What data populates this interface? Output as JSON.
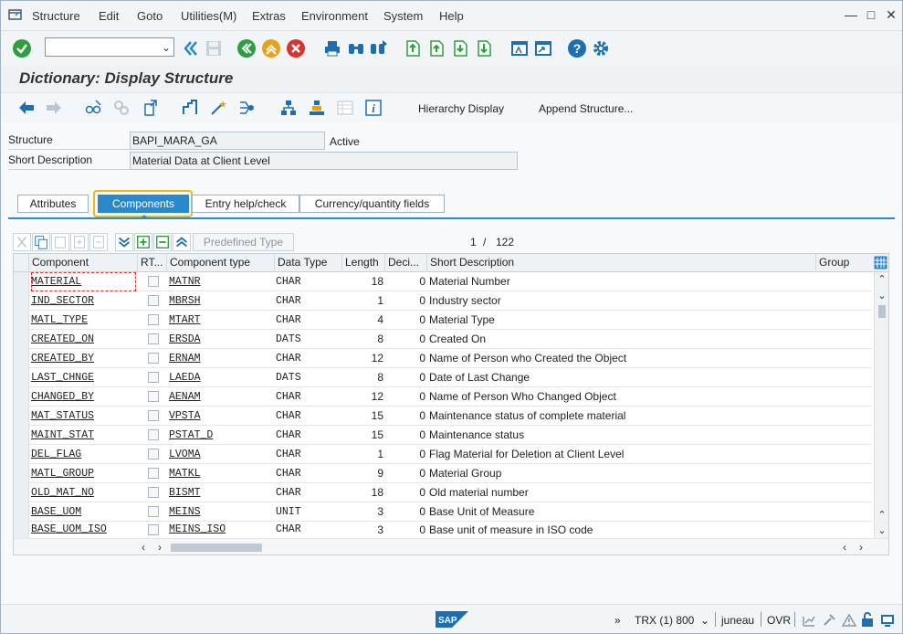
{
  "menubar": {
    "items": [
      "Structure",
      "Edit",
      "Goto",
      "Utilities(M)",
      "Extras",
      "Environment",
      "System",
      "Help"
    ]
  },
  "toolbar": {
    "command_field_value": ""
  },
  "title": "Dictionary: Display Structure",
  "apptoolbar": {
    "hierarchy_display": "Hierarchy Display",
    "append_structure": "Append Structure..."
  },
  "header": {
    "structure_label": "Structure",
    "structure_value": "BAPI_MARA_GA",
    "status": "Active",
    "short_desc_label": "Short Description",
    "short_desc_value": "Material Data at Client Level"
  },
  "tabs": [
    {
      "label": "Attributes",
      "active": false
    },
    {
      "label": "Components",
      "active": true
    },
    {
      "label": "Entry help/check",
      "active": false
    },
    {
      "label": "Currency/quantity fields",
      "active": false
    }
  ],
  "table_toolbar": {
    "predefined_type": "Predefined Type",
    "pager_current": "1",
    "pager_sep": "/",
    "pager_total": "122"
  },
  "grid": {
    "columns": [
      "Component",
      "RT...",
      "Component type",
      "Data Type",
      "Length",
      "Deci...",
      "Short Description",
      "Group"
    ],
    "rows": [
      {
        "component": "MATERIAL",
        "type": "MATNR",
        "dtype": "CHAR",
        "length": "18",
        "dec": "0",
        "desc": "Material Number"
      },
      {
        "component": "IND_SECTOR",
        "type": "MBRSH",
        "dtype": "CHAR",
        "length": "1",
        "dec": "0",
        "desc": "Industry sector"
      },
      {
        "component": "MATL_TYPE",
        "type": "MTART",
        "dtype": "CHAR",
        "length": "4",
        "dec": "0",
        "desc": "Material Type"
      },
      {
        "component": "CREATED_ON",
        "type": "ERSDA",
        "dtype": "DATS",
        "length": "8",
        "dec": "0",
        "desc": "Created On"
      },
      {
        "component": "CREATED_BY",
        "type": "ERNAM",
        "dtype": "CHAR",
        "length": "12",
        "dec": "0",
        "desc": "Name of Person who Created the Object"
      },
      {
        "component": "LAST_CHNGE",
        "type": "LAEDA",
        "dtype": "DATS",
        "length": "8",
        "dec": "0",
        "desc": "Date of Last Change"
      },
      {
        "component": "CHANGED_BY",
        "type": "AENAM",
        "dtype": "CHAR",
        "length": "12",
        "dec": "0",
        "desc": "Name of Person Who Changed Object"
      },
      {
        "component": "MAT_STATUS",
        "type": "VPSTA",
        "dtype": "CHAR",
        "length": "15",
        "dec": "0",
        "desc": "Maintenance status of complete material"
      },
      {
        "component": "MAINT_STAT",
        "type": "PSTAT_D",
        "dtype": "CHAR",
        "length": "15",
        "dec": "0",
        "desc": "Maintenance status"
      },
      {
        "component": "DEL_FLAG",
        "type": "LVOMA",
        "dtype": "CHAR",
        "length": "1",
        "dec": "0",
        "desc": "Flag Material for Deletion at Client Level"
      },
      {
        "component": "MATL_GROUP",
        "type": "MATKL",
        "dtype": "CHAR",
        "length": "9",
        "dec": "0",
        "desc": "Material Group"
      },
      {
        "component": "OLD_MAT_NO",
        "type": "BISMT",
        "dtype": "CHAR",
        "length": "18",
        "dec": "0",
        "desc": "Old material number"
      },
      {
        "component": "BASE_UOM",
        "type": "MEINS",
        "dtype": "UNIT",
        "length": "3",
        "dec": "0",
        "desc": "Base Unit of Measure"
      },
      {
        "component": "BASE_UOM_ISO",
        "type": "MEINS_ISO",
        "dtype": "CHAR",
        "length": "3",
        "dec": "0",
        "desc": "Base unit of measure in ISO code"
      }
    ]
  },
  "statusbar": {
    "logo": "SAP",
    "system": "TRX (1) 800",
    "server": "juneau",
    "mode": "OVR"
  },
  "colors": {
    "accent": "#2a88cc",
    "focus": "#f0b71a",
    "green": "#2e9e3e",
    "red": "#d9342b"
  }
}
